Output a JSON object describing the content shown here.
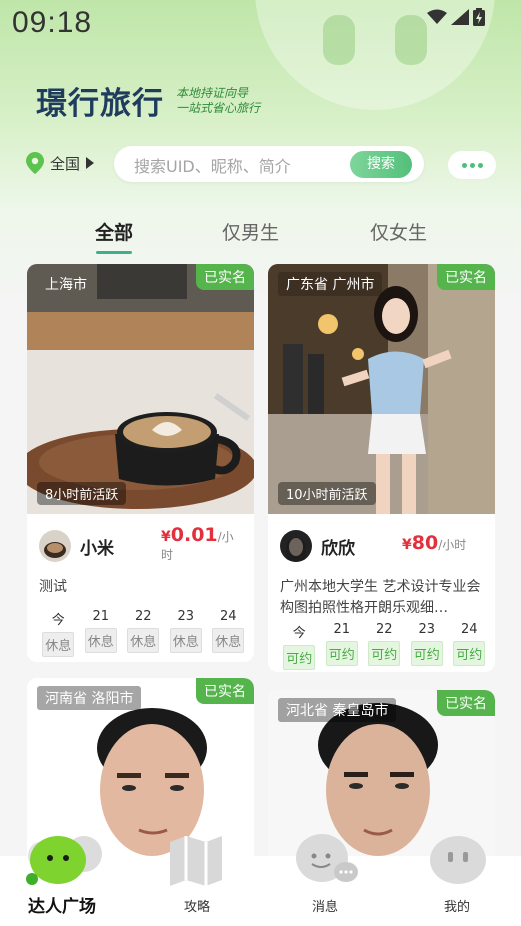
{
  "status_bar": {
    "time": "09:18"
  },
  "brand": {
    "name": "璟行旅行",
    "slogan_line1": "本地持证向导",
    "slogan_line2": "一站式省心旅行"
  },
  "location": {
    "label": "全国"
  },
  "search": {
    "placeholder": "搜索UID、昵称、简介",
    "button": "搜索"
  },
  "tabs": [
    {
      "label": "全部",
      "active": true
    },
    {
      "label": "仅男生"
    },
    {
      "label": "仅女生"
    }
  ],
  "cards": [
    {
      "location": "上海市",
      "verified": "已实名",
      "active": "8小时前活跃",
      "name": "小米",
      "price_currency": "¥",
      "price_value": "0.01",
      "price_unit": "/小时",
      "bio": "测试",
      "days": [
        {
          "d": "今",
          "s": "休息"
        },
        {
          "d": "21",
          "s": "休息"
        },
        {
          "d": "22",
          "s": "休息"
        },
        {
          "d": "23",
          "s": "休息"
        },
        {
          "d": "24",
          "s": "休息"
        }
      ]
    },
    {
      "location": "广东省 广州市",
      "verified": "已实名",
      "active": "10小时前活跃",
      "name": "欣欣",
      "price_currency": "¥",
      "price_value": "80",
      "price_unit": "/小时",
      "bio": "广州本地大学生 艺术设计专业会构图拍照性格开朗乐观细…",
      "days": [
        {
          "d": "今",
          "s": "可约"
        },
        {
          "d": "21",
          "s": "可约"
        },
        {
          "d": "22",
          "s": "可约"
        },
        {
          "d": "23",
          "s": "可约"
        },
        {
          "d": "24",
          "s": "可约"
        }
      ]
    },
    {
      "location": "河南省 洛阳市",
      "verified": "已实名"
    },
    {
      "location": "河北省 秦皇岛市",
      "verified": "已实名"
    }
  ],
  "nav": [
    {
      "label": "达人广场",
      "icon": "mascot-icon",
      "active": true
    },
    {
      "label": "攻略",
      "icon": "map-icon"
    },
    {
      "label": "消息",
      "icon": "chat-icon"
    },
    {
      "label": "我的",
      "icon": "profile-icon"
    }
  ],
  "colors": {
    "accent": "#52c07a",
    "price": "#e2303c",
    "verified": "#55b54c"
  }
}
